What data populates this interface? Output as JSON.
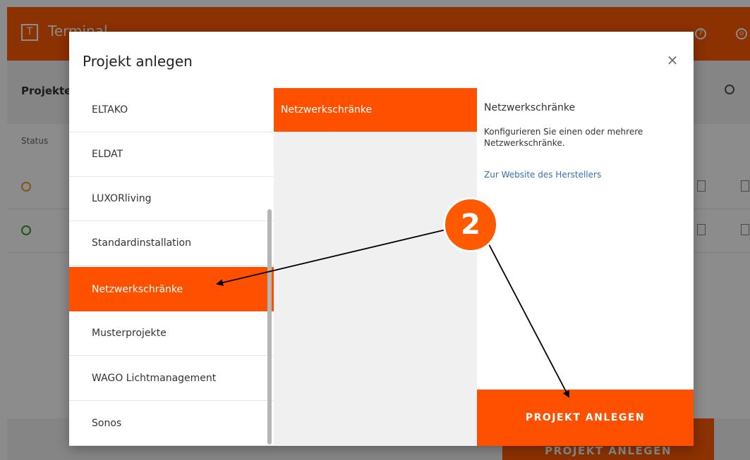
{
  "app": {
    "logo_glyph": "T",
    "title": "Terminal",
    "section_title": "Projekte",
    "status_column": "Status",
    "footer_button": "PROJEKT ANLEGEN",
    "rows": [
      {
        "status_color": "#e0a030"
      },
      {
        "status_color": "#3a9a3a"
      }
    ]
  },
  "modal": {
    "title": "Projekt anlegen",
    "close_glyph": "×",
    "manufacturers": [
      {
        "label": "ELTAKO"
      },
      {
        "label": "ELDAT"
      },
      {
        "label": "LUXORliving"
      },
      {
        "label": "Standardinstallation"
      },
      {
        "label": "Netzwerkschränke"
      },
      {
        "label": "Musterprojekte"
      },
      {
        "label": "WAGO Lichtmanagement"
      },
      {
        "label": "Sonos"
      }
    ],
    "active_manufacturer": "Netzwerkschränke",
    "templates": [
      {
        "label": "Netzwerkschränke"
      }
    ],
    "details": {
      "title": "Netzwerkschränke",
      "description": "Konfigurieren Sie einen oder mehrere Netzwerkschränke.",
      "link": "Zur Website des Herstellers"
    },
    "create_button": "PROJEKT ANLEGEN"
  },
  "annotation": {
    "step_number": "2"
  },
  "colors": {
    "accent": "#ff5000",
    "link": "#3a6fb0"
  }
}
